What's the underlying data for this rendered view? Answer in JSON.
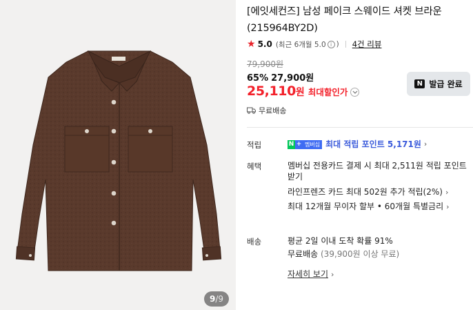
{
  "product": {
    "title": "[에잇세컨즈] 남성 페이크 스웨이드 셔켓 브라운 (215964BY2D)",
    "image_counter": {
      "current": "9",
      "total": "/9"
    },
    "jacket_color": "#5a3a2c"
  },
  "rating": {
    "star_icon": "★",
    "score": "5.0",
    "sub_label": "(최근 6개월 5.0",
    "sub_suffix": ")",
    "info_icon": "i",
    "review_link": "4건 리뷰"
  },
  "price": {
    "original": "79,900원",
    "discount_pct": "65%",
    "sale": "27,900원",
    "max_discount_price": "25,110",
    "max_discount_won": "원",
    "max_discount_label": "최대할인가"
  },
  "coupon": {
    "badge": "N",
    "label": "발급 완료"
  },
  "shipping_summary": "무료배송",
  "details": {
    "points_label": "적립",
    "points_badge_n": "N",
    "points_badge_plus": "+",
    "points_badge_text": "멤버십",
    "points_text": "최대 적립 포인트 5,171원",
    "benefits_label": "혜택",
    "benefit_1": "멤버십 전용카드 결제 시 최대 2,511원 적립 포인트 받기",
    "benefit_2": "라인프렌즈 카드 최대 502원 추가 적립(2%)",
    "benefit_3": "최대 12개월 무이자 할부 • 60개월 특별금리",
    "delivery_label": "배송",
    "delivery_1": "평균 2일 이내 도착 확률 91%",
    "delivery_2": "무료배송",
    "delivery_2_sub": "(39,900원 이상 무료)",
    "detail_link": "자세히 보기"
  },
  "colors": {
    "accent_red": "#f3202a",
    "points_blue": "#3b5bdb",
    "naver_green": "#03c75a"
  }
}
